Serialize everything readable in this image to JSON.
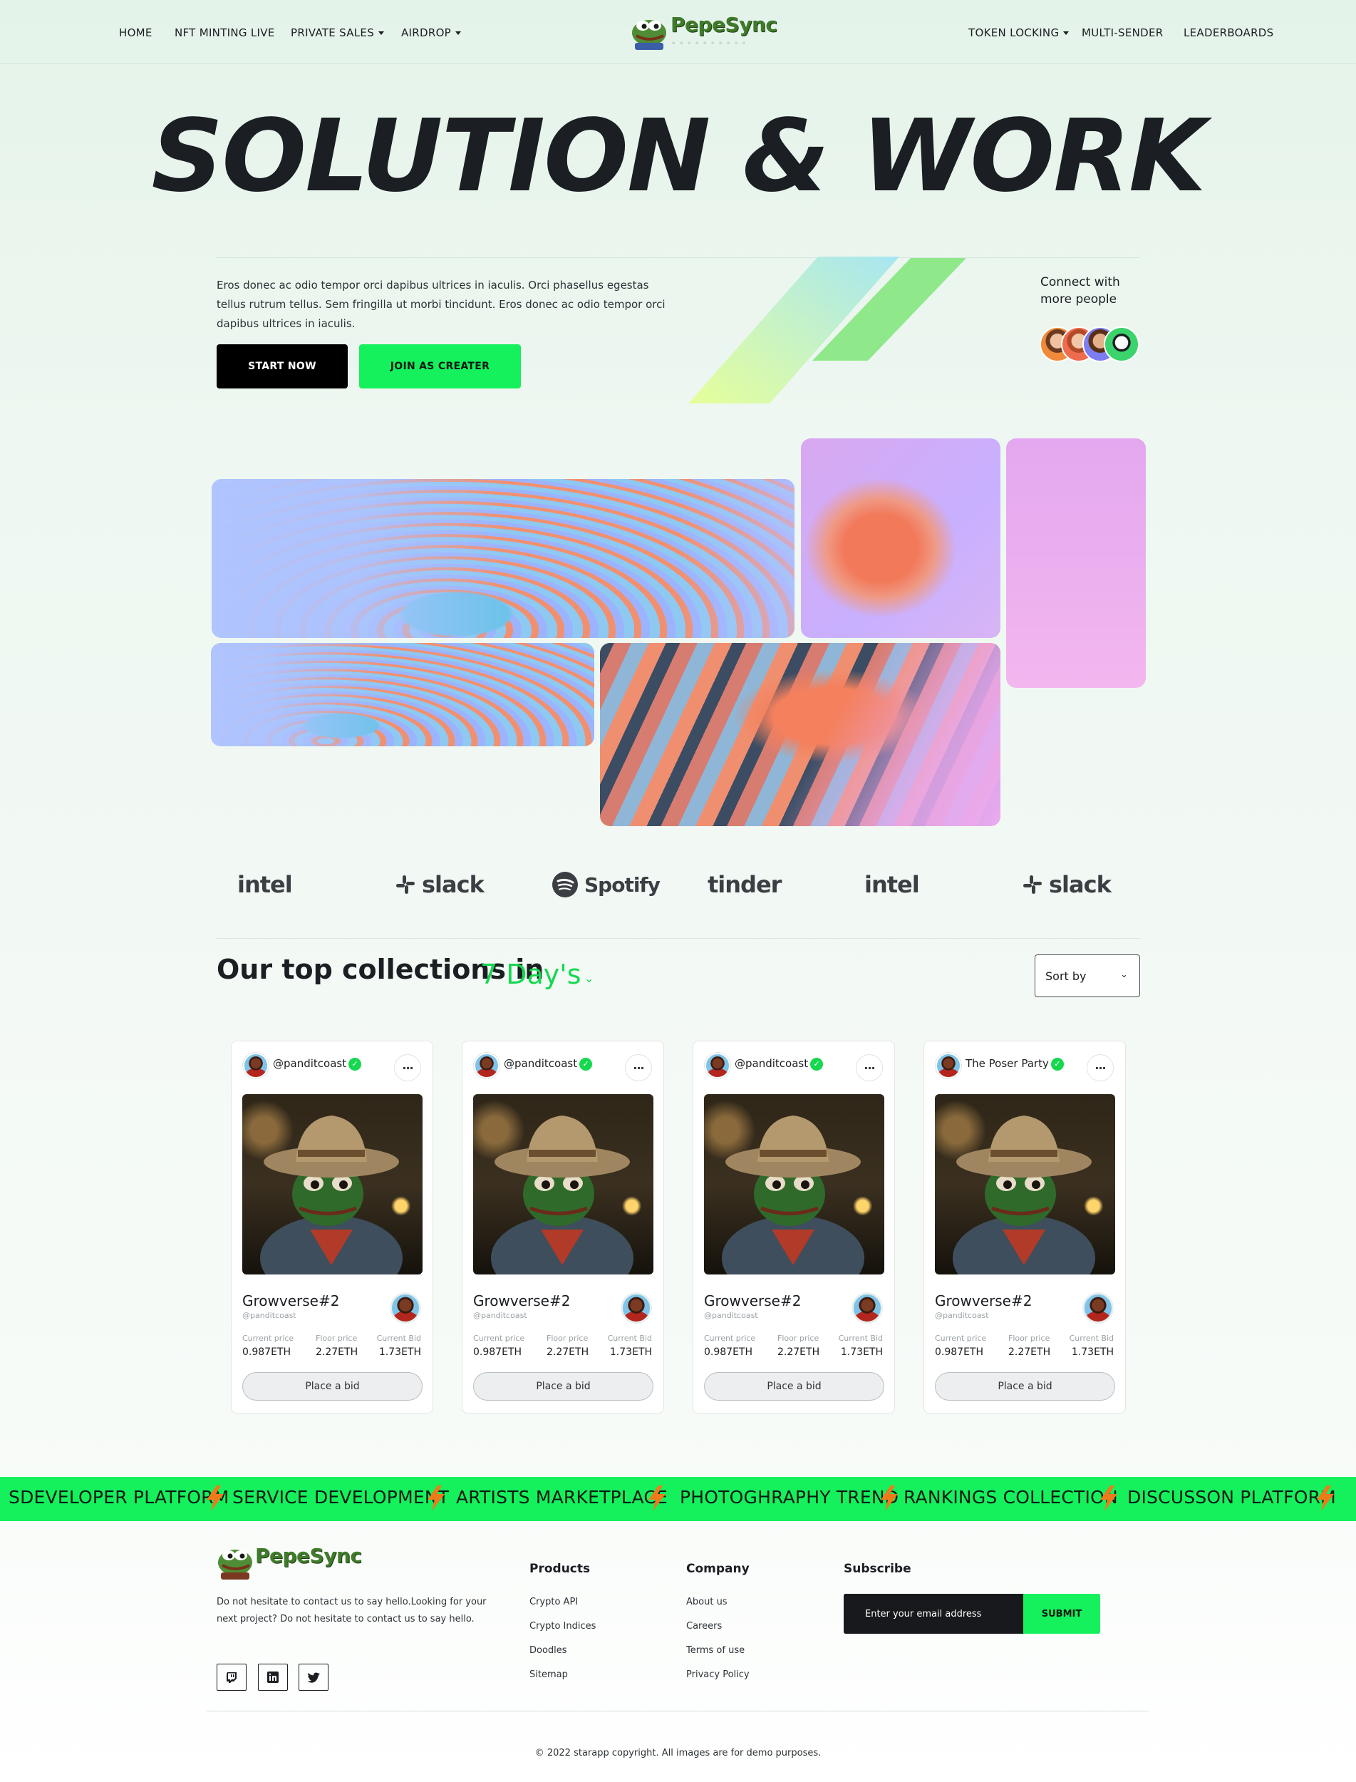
{
  "nav": {
    "left": [
      {
        "label": "HOME"
      },
      {
        "label": "NFT MINTING LIVE"
      },
      {
        "label": "PRIVATE SALES"
      },
      {
        "label": "AIRDROP"
      }
    ],
    "right": [
      {
        "label": "TOKEN LOCKING"
      },
      {
        "label": "MULTI-SENDER"
      },
      {
        "label": "LEADERBOARDS"
      }
    ],
    "logo_text": "PepeSync"
  },
  "hero": {
    "title": "SOLUTION & WORK",
    "description": "Eros donec ac odio tempor orci dapibus ultrices in iaculis. Orci phasellus egestas tellus rutrum tellus. Sem fringilla ut morbi tincidunt. Eros donec ac odio tempor orci dapibus ultrices in iaculis.",
    "start_label": "START NOW",
    "join_label": "JOIN AS CREATER",
    "connect_line1": "Connect with",
    "connect_line2": "more people"
  },
  "brands": [
    {
      "name": "intel",
      "icon": "none"
    },
    {
      "name": "slack",
      "icon": "slack-icon"
    },
    {
      "name": "Spotify",
      "icon": "spotify-icon"
    },
    {
      "name": "tinder",
      "icon": "none"
    },
    {
      "name": "intel",
      "icon": "none"
    },
    {
      "name": "slack",
      "icon": "slack-icon"
    }
  ],
  "collections": {
    "title": "Our top collections in",
    "period": "7 Day's",
    "sort_label": "Sort by",
    "cards": [
      {
        "user": "@panditcoast",
        "name": "Growverse#2",
        "handle": "@panditcoast",
        "current_label": "Current price",
        "current": "0.987ETH",
        "floor_label": "Floor price",
        "floor": "2.27ETH",
        "bid_label": "Current Bid",
        "bid": "1.73ETH",
        "button": "Place a bid"
      },
      {
        "user": "@panditcoast",
        "name": "Growverse#2",
        "handle": "@panditcoast",
        "current_label": "Current price",
        "current": "0.987ETH",
        "floor_label": "Floor price",
        "floor": "2.27ETH",
        "bid_label": "Current Bid",
        "bid": "1.73ETH",
        "button": "Place a bid"
      },
      {
        "user": "@panditcoast",
        "name": "Growverse#2",
        "handle": "@panditcoast",
        "current_label": "Current price",
        "current": "0.987ETH",
        "floor_label": "Floor price",
        "floor": "2.27ETH",
        "bid_label": "Current Bid",
        "bid": "1.73ETH",
        "button": "Place a bid"
      },
      {
        "user": "The Poser Party",
        "name": "Growverse#2",
        "handle": "@panditcoast",
        "current_label": "Current price",
        "current": "0.987ETH",
        "floor_label": "Floor price",
        "floor": "2.27ETH",
        "bid_label": "Current Bid",
        "bid": "1.73ETH",
        "button": "Place a bid"
      }
    ]
  },
  "marquee": [
    "SDEVELOPER PLATFORM",
    "SERVICE DEVELOPMENT",
    "ARTISTS MARKETPLACE",
    "PHOTOGHRAPHY TREND",
    "RANKINGS COLLECTION",
    "DISCUSSON PLATFORM"
  ],
  "footer": {
    "logo_text": "PepeSync",
    "description": "Do not hesitate to contact us to say hello.Looking for your next project? Do not hesitate to contact us to say hello.",
    "products_title": "Products",
    "products": [
      "Crypto API",
      "Crypto Indices",
      "Doodles",
      "Sitemap"
    ],
    "company_title": "Company",
    "company": [
      "About us",
      "Careers",
      "Terms of use",
      "Privacy Policy"
    ],
    "subscribe_title": "Subscribe",
    "email_placeholder": "Enter your email address",
    "submit_label": "SUBMIT",
    "social": [
      "twitch-icon",
      "linkedin-icon",
      "twitter-icon"
    ],
    "copyright": "© 2022 starapp copyright. All images are for demo purposes."
  },
  "colors": {
    "accent_green": "#15f15d",
    "text_dark": "#1b1e22",
    "background_mint": "#e4f3e9"
  }
}
